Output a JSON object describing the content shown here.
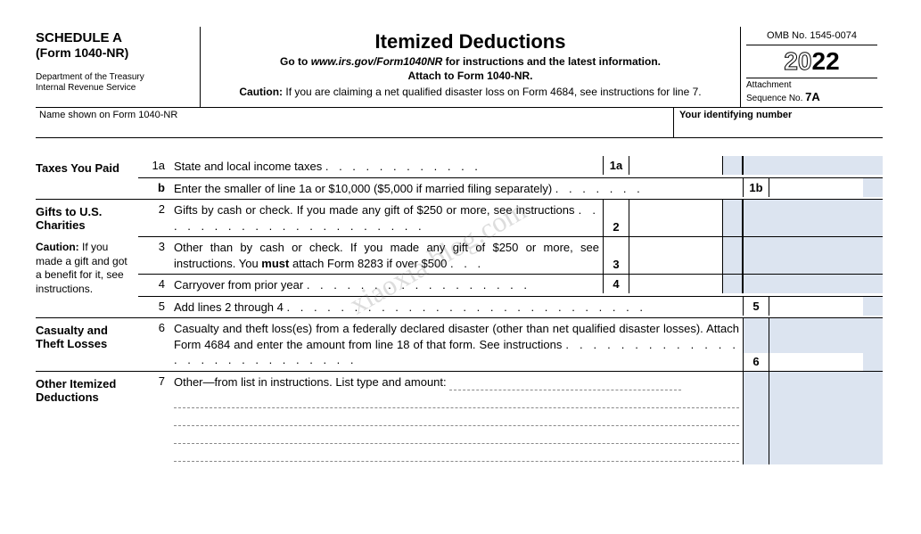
{
  "header": {
    "schedule": "SCHEDULE A",
    "form": "(Form 1040-NR)",
    "dept1": "Department of the Treasury",
    "dept2": "Internal Revenue Service",
    "title": "Itemized Deductions",
    "goto_prefix": "Go to ",
    "goto_url": "www.irs.gov/Form1040NR",
    "goto_suffix": " for instructions and the latest information.",
    "attach": "Attach to Form 1040-NR.",
    "caution_bold": "Caution:",
    "caution_text": " If you are claiming a net qualified disaster loss on Form 4684, see instructions for line 7.",
    "omb": "OMB No. 1545-0074",
    "year_outline": "20",
    "year_solid": "22",
    "seq_label": "Attachment",
    "seq_text": "Sequence No. ",
    "seq_num": "7A"
  },
  "name_row": {
    "left": "Name shown on Form 1040-NR",
    "right": "Your identifying number"
  },
  "sections": {
    "taxes": {
      "title": "Taxes You Paid"
    },
    "gifts": {
      "title": "Gifts to U.S. Charities",
      "caution_bold": "Caution:",
      "caution_text": " If you made a gift and got a benefit for it, see instructions."
    },
    "casualty": {
      "title": "Casualty and Theft Losses"
    },
    "other": {
      "title": "Other Itemized Deductions"
    }
  },
  "lines": {
    "l1a_num": "1a",
    "l1a_text": "State and local income taxes",
    "l1a_label": "1a",
    "l1b_num": "b",
    "l1b_text": "Enter the smaller of line 1a or $10,000 ($5,000 if married filing separately)",
    "l1b_label": "1b",
    "l2_num": "2",
    "l2_text": "Gifts by cash or check. If you made any gift of $250 or more, see instructions",
    "l2_label": "2",
    "l3_num": "3",
    "l3_text_a": "Other than by cash or check. If you made any gift of $250 or more, see instructions. You ",
    "l3_must": "must",
    "l3_text_b": " attach Form 8283 if over $500",
    "l3_label": "3",
    "l4_num": "4",
    "l4_text": "Carryover from prior year",
    "l4_label": "4",
    "l5_num": "5",
    "l5_text": "Add lines 2 through 4",
    "l5_label": "5",
    "l6_num": "6",
    "l6_text": "Casualty and theft loss(es) from a federally declared disaster (other than net qualified disaster losses). Attach Form 4684 and enter the amount from line 18 of that form. See instructions",
    "l6_label": "6",
    "l7_num": "7",
    "l7_text": "Other—from list in instructions. List type and amount:"
  },
  "watermark": "xiaoxia blog.com"
}
